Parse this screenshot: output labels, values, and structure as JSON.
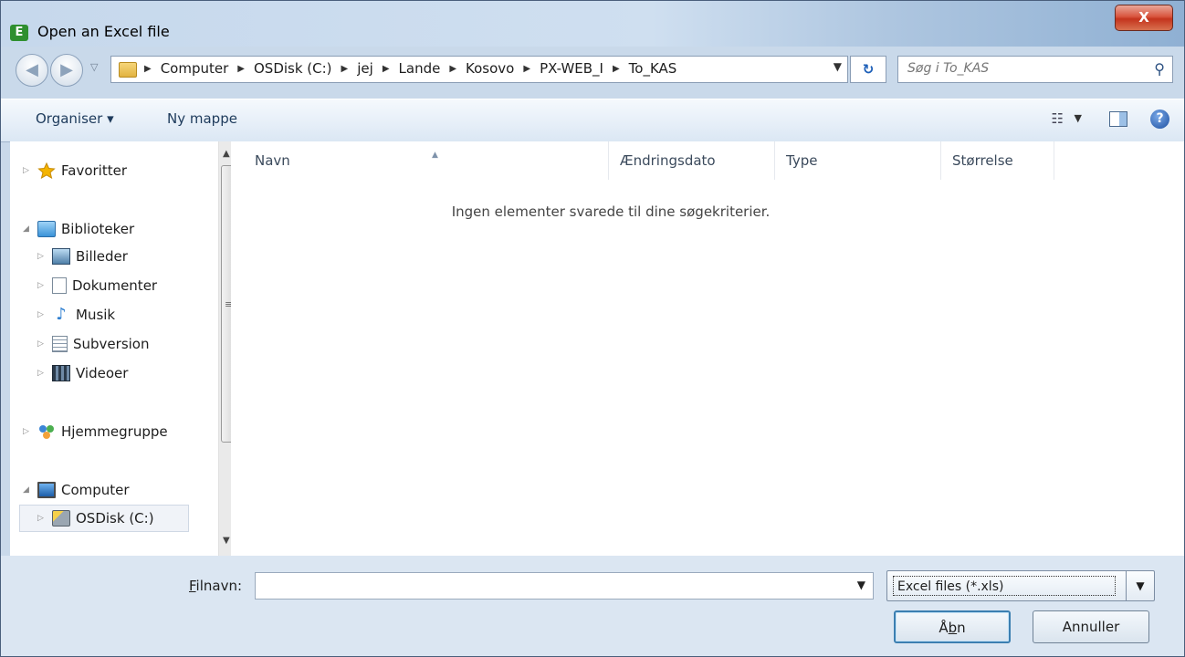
{
  "window": {
    "title": "Open an Excel file",
    "app_icon": "E",
    "close_symbol": "X"
  },
  "address": {
    "crumbs": [
      "Computer",
      "OSDisk (C:)",
      "jej",
      "Lande",
      "Kosovo",
      "PX-WEB_I",
      "To_KAS"
    ],
    "search_placeholder": "Søg i To_KAS"
  },
  "toolbar": {
    "organise": "Organiser ▾",
    "new_folder": "Ny mappe"
  },
  "nav": {
    "favorites": "Favoritter",
    "libraries": "Biblioteker",
    "pictures": "Billeder",
    "documents": "Dokumenter",
    "music": "Musik",
    "subversion": "Subversion",
    "videos": "Videoer",
    "homegroup": "Hjemmegruppe",
    "computer": "Computer",
    "osdisk": "OSDisk (C:)"
  },
  "columns": {
    "name": "Navn",
    "date": "Ændringsdato",
    "type": "Type",
    "size": "Størrelse"
  },
  "empty_message": "Ingen elementer svarede til dine søgekriterier.",
  "bottom": {
    "filename_label_first": "F",
    "filename_label_rest": "ilnavn:",
    "filename_value": "",
    "filter": "Excel files (*.xls)",
    "open_label_a": "Å",
    "open_label_b": "b",
    "open_label_c": "n",
    "cancel_label": "Annuller"
  }
}
